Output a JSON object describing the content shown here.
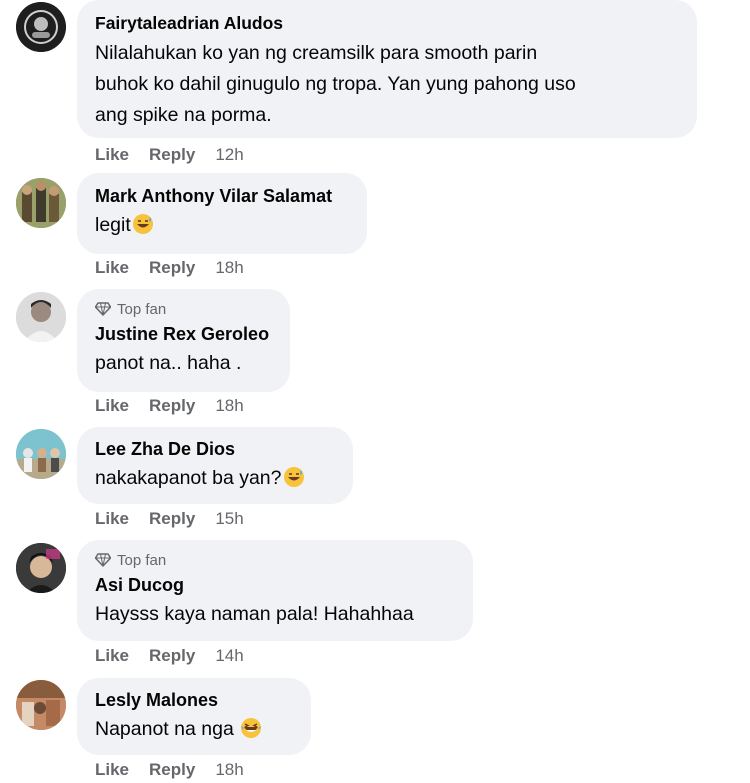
{
  "comments": [
    {
      "author": "Fairytaleadrian Aludos",
      "top_fan": "",
      "text_lines": [
        "Nilalahukan ko yan ng creamsilk para smooth parin",
        "buhok ko dahil ginugulo ng tropa. Yan yung pahong uso",
        "ang spike na porma."
      ],
      "emoji": "",
      "like": "Like",
      "reply": "Reply",
      "time": "12h"
    },
    {
      "author": "Mark Anthony Vilar Salamat",
      "top_fan": "",
      "text_lines": [
        "legit"
      ],
      "emoji": "grinning-sweat-emoji",
      "like": "Like",
      "reply": "Reply",
      "time": "18h"
    },
    {
      "author": "Justine Rex Geroleo",
      "top_fan": "Top fan",
      "text_lines": [
        "panot na.. haha ."
      ],
      "emoji": "",
      "like": "Like",
      "reply": "Reply",
      "time": "18h"
    },
    {
      "author": "Lee Zha De Dios",
      "top_fan": "",
      "text_lines": [
        "nakakapanot ba yan?"
      ],
      "emoji": "grinning-sweat-emoji",
      "like": "Like",
      "reply": "Reply",
      "time": "15h"
    },
    {
      "author": "Asi Ducog",
      "top_fan": "Top fan",
      "text_lines": [
        "Haysss kaya naman pala! Hahahhaa"
      ],
      "emoji": "",
      "like": "Like",
      "reply": "Reply",
      "time": "14h"
    },
    {
      "author": "Lesly Malones",
      "top_fan": "",
      "text_lines": [
        "Napanot na nga "
      ],
      "emoji": "laughing-tears-emoji",
      "like": "Like",
      "reply": "Reply",
      "time": "18h"
    }
  ],
  "icons": {
    "top_fan_badge": "diamond-icon"
  },
  "colors": {
    "bubble": "#f0f2f5",
    "meta": "#65676b",
    "text": "#050505",
    "emoji": "#f7c33a"
  }
}
